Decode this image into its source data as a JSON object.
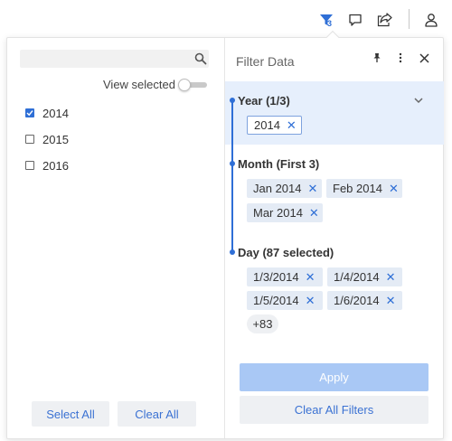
{
  "toolbar": {
    "filter_count": "3",
    "icons": [
      "filter-icon",
      "comment-icon",
      "share-icon",
      "user-icon"
    ]
  },
  "left": {
    "search_placeholder": "",
    "view_selected_label": "View selected",
    "view_selected_on": false,
    "years": [
      {
        "label": "2014",
        "checked": true
      },
      {
        "label": "2015",
        "checked": false
      },
      {
        "label": "2016",
        "checked": false
      }
    ],
    "select_all_label": "Select All",
    "clear_all_label": "Clear All"
  },
  "right": {
    "title": "Filter Data",
    "sections": {
      "year": {
        "title": "Year (1/3)",
        "chips": [
          "2014"
        ]
      },
      "month": {
        "title": "Month (First 3)",
        "chips": [
          "Jan 2014",
          "Feb 2014",
          "Mar 2014"
        ]
      },
      "day": {
        "title": "Day (87 selected)",
        "chips": [
          "1/3/2014",
          "1/4/2014",
          "1/5/2014",
          "1/6/2014"
        ],
        "more": "+83"
      }
    },
    "apply_label": "Apply",
    "clear_all_filters_label": "Clear All Filters"
  },
  "colors": {
    "accent": "#2f6fd6",
    "selected_section_bg": "#e6effc",
    "chip_bg": "#e4ebf5",
    "apply_disabled": "#a9c8f5"
  }
}
